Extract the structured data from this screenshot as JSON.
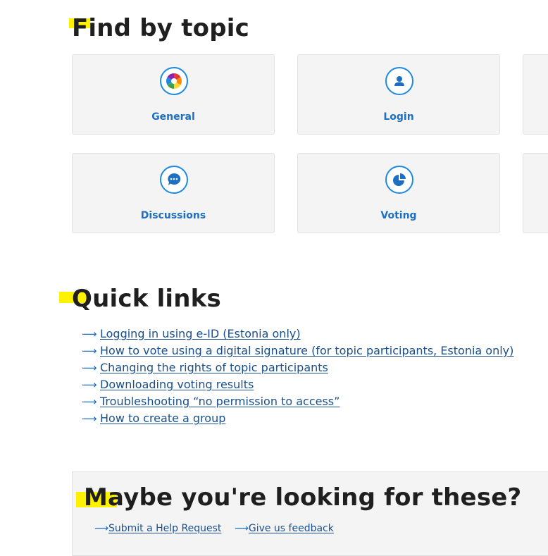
{
  "find_by_topic": {
    "title": "Find by topic",
    "topics": [
      {
        "label": "General",
        "icon": "general-icon"
      },
      {
        "label": "Login",
        "icon": "user-icon"
      },
      {
        "label": "Discussions",
        "icon": "chat-bubble-icon"
      },
      {
        "label": "Voting",
        "icon": "pie-chart-icon"
      }
    ]
  },
  "quick_links": {
    "title": "Quick links",
    "items": [
      "Logging in using e-ID (Estonia only)",
      "How to vote using a digital signature (for topic participants, Estonia only)",
      "Changing the rights of topic participants",
      "Downloading voting results",
      "Troubleshooting “no permission to access”",
      "How to create a group"
    ]
  },
  "looking_for": {
    "title": "Maybe you're looking for these?",
    "links": [
      "Submit a Help Request",
      "Give us feedback"
    ]
  },
  "colors": {
    "accent": "#1e88e5",
    "link": "#1a4f8a",
    "highlight": "#fff200"
  }
}
